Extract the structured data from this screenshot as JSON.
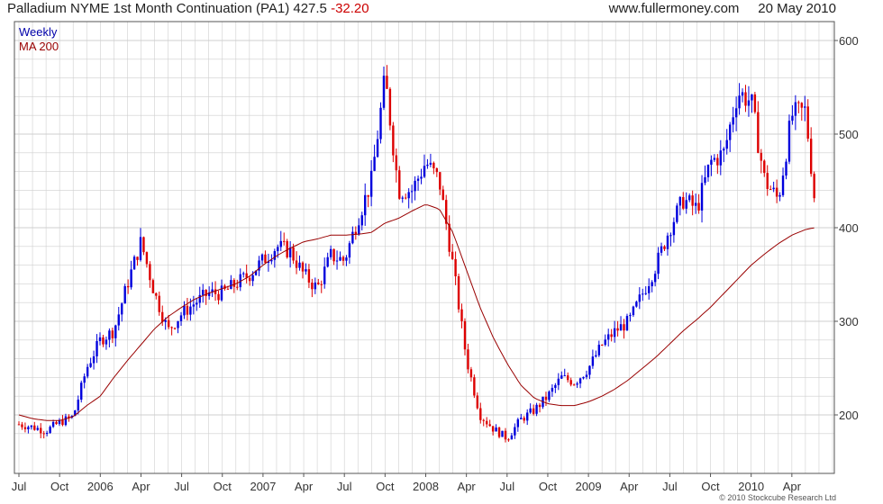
{
  "header": {
    "title": "Palladium NYME 1st Month Continuation (PA1) 427.5",
    "change": "-32.20",
    "site": "www.fullermoney.com",
    "date": "20 May 2010"
  },
  "legend": {
    "weekly": "Weekly",
    "ma": "MA 200"
  },
  "copyright": "© 2010 Stockcube Research Ltd",
  "colors": {
    "up": "#0000dd",
    "down": "#dd0000",
    "ma": "#990000",
    "grid": "#cfcfcf",
    "frame": "#555555"
  },
  "chart_data": {
    "type": "candlestick",
    "title": "Palladium NYME 1st Month Continuation (PA1) 427.5 -32.20",
    "period": "Weekly",
    "ylim": [
      165,
      600
    ],
    "yticks": [
      200,
      300,
      400,
      500,
      600
    ],
    "x_tick_labels": [
      "Jul",
      "Oct",
      "2006",
      "Apr",
      "Jul",
      "Oct",
      "2007",
      "Apr",
      "Jul",
      "Oct",
      "2008",
      "Apr",
      "Jul",
      "Oct",
      "2009",
      "Apr",
      "Jul",
      "Oct",
      "2010",
      "Apr"
    ],
    "ohlc_anchor_months_from_jul2005": [
      0,
      1,
      2,
      3,
      4,
      5,
      6,
      7,
      8,
      9,
      10,
      11,
      12,
      13,
      14,
      15,
      16,
      17,
      18,
      19,
      20,
      21,
      22,
      23,
      24,
      25,
      26,
      27,
      28,
      29,
      30,
      31,
      32,
      33,
      34,
      35,
      36,
      37,
      38,
      39,
      40,
      41,
      42,
      43,
      44,
      45,
      46,
      47,
      48,
      49,
      50,
      51,
      52,
      53,
      54,
      55,
      56,
      57,
      58,
      58.7
    ],
    "close_estimates": [
      190,
      187,
      183,
      192,
      198,
      250,
      280,
      290,
      340,
      385,
      330,
      290,
      308,
      320,
      330,
      330,
      340,
      350,
      365,
      380,
      375,
      350,
      335,
      370,
      365,
      410,
      450,
      560,
      440,
      440,
      470,
      450,
      360,
      260,
      200,
      185,
      175,
      195,
      205,
      220,
      240,
      235,
      250,
      275,
      290,
      300,
      330,
      360,
      400,
      430,
      420,
      470,
      480,
      545,
      535,
      450,
      430,
      520,
      525,
      427.5
    ],
    "ma200_estimates": [
      200,
      196,
      194,
      194,
      198,
      210,
      220,
      240,
      258,
      275,
      292,
      305,
      315,
      324,
      330,
      335,
      340,
      348,
      360,
      370,
      378,
      385,
      388,
      392,
      392,
      393,
      395,
      405,
      410,
      418,
      425,
      420,
      395,
      355,
      315,
      282,
      255,
      232,
      218,
      212,
      210,
      210,
      214,
      220,
      228,
      238,
      250,
      262,
      276,
      290,
      302,
      315,
      330,
      345,
      360,
      372,
      383,
      392,
      398,
      400
    ]
  }
}
